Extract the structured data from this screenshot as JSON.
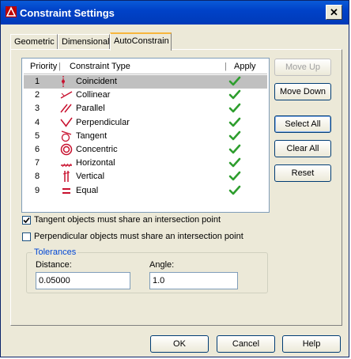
{
  "window": {
    "title": "Constraint Settings",
    "close_glyph": "✕"
  },
  "tabs": [
    "Geometric",
    "Dimensional",
    "AutoConstrain"
  ],
  "table": {
    "columns": [
      "Priority",
      "Constraint Type",
      "Apply"
    ],
    "rows": [
      {
        "priority": "1",
        "name": "Coincident",
        "icon": "coincident-icon",
        "selected": true
      },
      {
        "priority": "2",
        "name": "Collinear",
        "icon": "collinear-icon"
      },
      {
        "priority": "3",
        "name": "Parallel",
        "icon": "parallel-icon"
      },
      {
        "priority": "4",
        "name": "Perpendicular",
        "icon": "perpendicular-icon"
      },
      {
        "priority": "5",
        "name": "Tangent",
        "icon": "tangent-icon"
      },
      {
        "priority": "6",
        "name": "Concentric",
        "icon": "concentric-icon"
      },
      {
        "priority": "7",
        "name": "Horizontal",
        "icon": "horizontal-icon"
      },
      {
        "priority": "8",
        "name": "Vertical",
        "icon": "vertical-icon"
      },
      {
        "priority": "9",
        "name": "Equal",
        "icon": "equal-icon"
      }
    ]
  },
  "side_buttons": {
    "move_up": "Move Up",
    "move_down": "Move Down",
    "select_all": "Select All",
    "clear_all": "Clear All",
    "reset": "Reset"
  },
  "options": {
    "tangent": {
      "label": "Tangent objects must share an intersection point",
      "checked": true
    },
    "perpendicular": {
      "label": "Perpendicular objects must share an intersection point",
      "checked": false
    }
  },
  "tolerances": {
    "title": "Tolerances",
    "distance_label": "Distance:",
    "distance_value": "0.05000",
    "angle_label": "Angle:",
    "angle_value": "1.0"
  },
  "footer": {
    "ok": "OK",
    "cancel": "Cancel",
    "help": "Help"
  },
  "colors": {
    "check": "#2e9e2e",
    "icon_red": "#c8102e",
    "title_bar": "#0a5ad8"
  }
}
